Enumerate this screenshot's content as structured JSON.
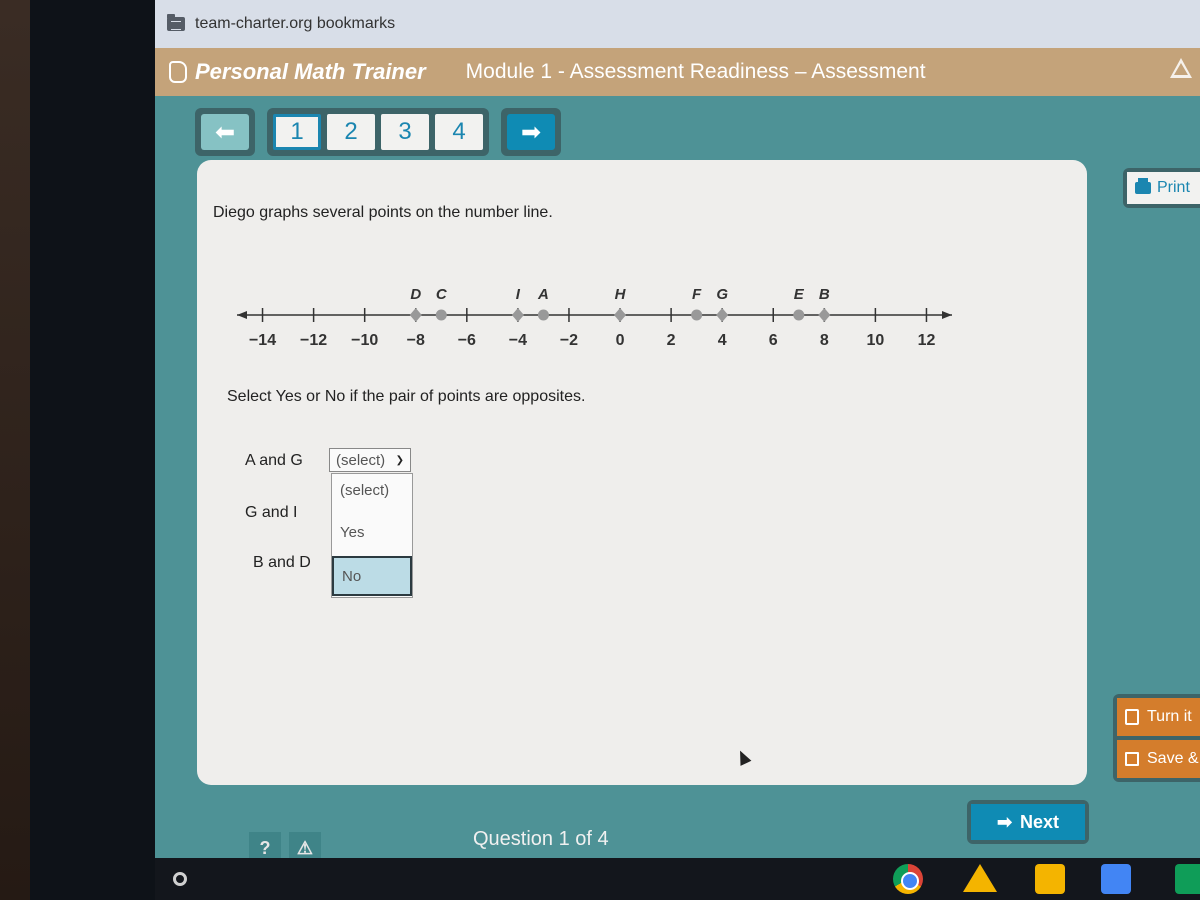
{
  "browser": {
    "bookmarks_label": "team-charter.org bookmarks"
  },
  "header": {
    "brand": "Personal Math Trainer",
    "module_title": "Module 1 - Assessment Readiness – Assessment"
  },
  "nav": {
    "prev_icon": "⬅",
    "next_icon": "➡",
    "pages": [
      "1",
      "2",
      "3",
      "4"
    ],
    "active_page": "1"
  },
  "question": {
    "prompt": "Diego graphs several points on the number line.",
    "instruction": "Select Yes or No if the pair of points are opposites.",
    "pairs": [
      {
        "label": "A and G",
        "value": "(select)"
      },
      {
        "label": "G and I",
        "value": ""
      },
      {
        "label": "B and D",
        "value": ""
      }
    ],
    "dropdown": {
      "open": true,
      "options": [
        "(select)",
        "Yes",
        "No"
      ],
      "highlighted": "No"
    }
  },
  "number_line": {
    "ticks": [
      -14,
      -12,
      -10,
      -8,
      -6,
      -4,
      -2,
      0,
      2,
      4,
      6,
      8,
      10,
      12
    ],
    "tick_labels": [
      "−14",
      "−12",
      "−10",
      "−8",
      "−6",
      "−4",
      "−2",
      "0",
      "2",
      "4",
      "6",
      "8",
      "10",
      "12"
    ],
    "range": [
      -15,
      13
    ],
    "points": [
      {
        "label": "D",
        "value": -8,
        "marker": "diamond"
      },
      {
        "label": "C",
        "value": -7,
        "marker": "circle"
      },
      {
        "label": "I",
        "value": -4,
        "marker": "diamond"
      },
      {
        "label": "A",
        "value": -3,
        "marker": "circle"
      },
      {
        "label": "H",
        "value": 0,
        "marker": "diamond"
      },
      {
        "label": "F",
        "value": 3,
        "marker": "circle"
      },
      {
        "label": "G",
        "value": 4,
        "marker": "diamond"
      },
      {
        "label": "E",
        "value": 7,
        "marker": "circle"
      },
      {
        "label": "B",
        "value": 8,
        "marker": "diamond"
      }
    ]
  },
  "side": {
    "print_label": "Print",
    "turn_in_label": "Turn it",
    "save_label": "Save &"
  },
  "footer": {
    "help_label": "?",
    "warn_label": "⚠",
    "counter": "Question 1 of 4",
    "next_label": "Next",
    "next_icon": "➡"
  },
  "colors": {
    "teal_bg": "#4e9296",
    "header_tan": "#c4a37a",
    "accent_blue": "#0f8bb4",
    "orange": "#d47d2c",
    "highlight": "#bcdce6"
  }
}
